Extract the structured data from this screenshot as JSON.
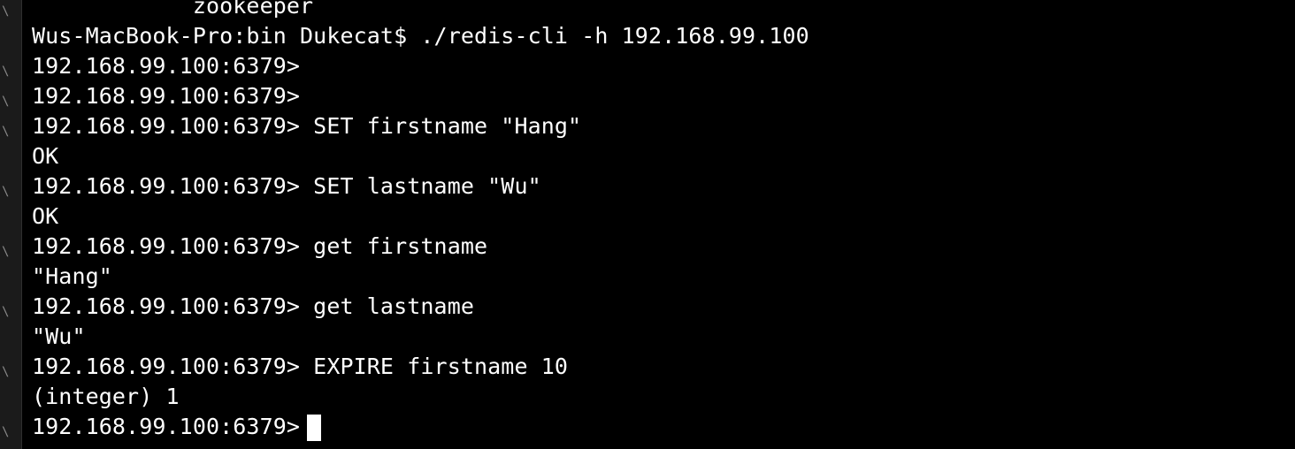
{
  "terminal": {
    "lines": [
      "            zookeeper",
      "Wus-MacBook-Pro:bin Dukecat$ ./redis-cli -h 192.168.99.100",
      "192.168.99.100:6379>",
      "192.168.99.100:6379>",
      "192.168.99.100:6379> SET firstname \"Hang\"",
      "OK",
      "192.168.99.100:6379> SET lastname \"Wu\"",
      "OK",
      "192.168.99.100:6379> get firstname",
      "\"Hang\"",
      "192.168.99.100:6379> get lastname",
      "\"Wu\"",
      "192.168.99.100:6379> EXPIRE firstname 10",
      "(integer) 1",
      "192.168.99.100:6379>"
    ],
    "gutter_mark": "\\"
  },
  "colors": {
    "background": "#000000",
    "foreground": "#ffffff",
    "gutter": "#1b1b1b",
    "marker": "#6aa9ff"
  }
}
